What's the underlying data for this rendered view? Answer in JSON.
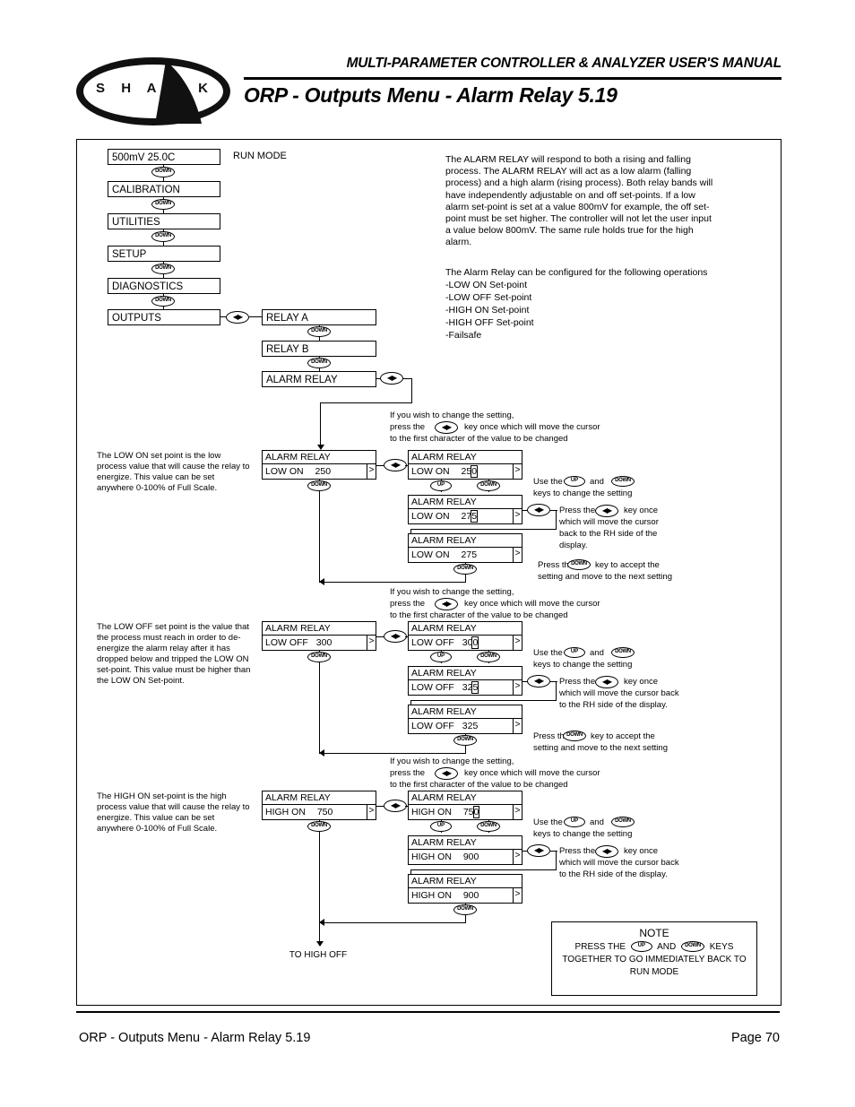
{
  "header": {
    "manual_title": "MULTI-PARAMETER CONTROLLER & ANALYZER USER'S MANUAL",
    "page_heading": "ORP - Outputs Menu - Alarm Relay 5.19",
    "logo_text": "S H A R K"
  },
  "footer": {
    "left": "ORP - Outputs Menu - Alarm Relay 5.19",
    "right": "Page 70"
  },
  "keys": {
    "down": "DOWN",
    "up": "UP",
    "leftright": "◀▶"
  },
  "menu": {
    "run_mode_label": "RUN MODE",
    "items": [
      {
        "label": "500mV  25.0C"
      },
      {
        "label": "CALIBRATION"
      },
      {
        "label": "UTILITIES"
      },
      {
        "label": "SETUP"
      },
      {
        "label": "DIAGNOSTICS"
      },
      {
        "label": "OUTPUTS"
      }
    ],
    "relays": [
      {
        "label": "RELAY A"
      },
      {
        "label": "RELAY B"
      },
      {
        "label": "ALARM RELAY"
      }
    ]
  },
  "description": {
    "paragraph": "The ALARM RELAY will respond to both a rising and falling process. The ALARM RELAY will act as a low alarm (falling process) and a high alarm (rising process). Both relay bands will have independently adjustable on and off set-points.  If a low alarm set-point is set at a value 800mV for example, the off set-point must be set higher. The controller will not let the user input a value below 800mV. The same rule holds true for the high alarm.",
    "config_intro": "The Alarm Relay can be configured for the following operations",
    "config_items": [
      "-LOW ON Set-point",
      "-LOW OFF Set-point",
      "-HIGH ON Set-point",
      "-HIGH OFF Set-point",
      "-Failsafe"
    ]
  },
  "instructions": {
    "change_setting_l1": "If you wish to change the setting,",
    "change_setting_l2a": "press the",
    "change_setting_l2b": "key once which will move the cursor",
    "change_setting_l3": "to the first character of the value to be changed",
    "use_keys_a": "Use the",
    "use_keys_b": "and",
    "use_keys_c": "keys to change the setting",
    "press_lr_a": "Press the",
    "press_lr_b": "key once",
    "press_lr_c2": "which will move the cursor",
    "press_lr_c3": "back to the RH side of the",
    "press_lr_c4": "display.",
    "press_lr_w2": "which will move the cursor back",
    "press_lr_w3": "to the RH side of the display.",
    "accept_a": "Press the",
    "accept_b": "key to accept the",
    "accept_c": "setting and move to the next setting"
  },
  "sections": [
    {
      "id": "low-on",
      "note": "The LOW ON set point is the low process value that will cause the relay to energize. This value can be set anywhere 0-100% of Full Scale.",
      "lcd_title": "ALARM RELAY",
      "main": {
        "label": "LOW  ON",
        "value": "250"
      },
      "edit1": {
        "label": "LOW  ON",
        "value_pre": "25",
        "value_hl": "0"
      },
      "edit2": {
        "label": "LOW  ON",
        "value_pre": "27",
        "value_hl": "5"
      },
      "final": {
        "label": "LOW  ON",
        "value": "275"
      }
    },
    {
      "id": "low-off",
      "note": "The LOW OFF set point is the value that the process must reach in order to de-energize the alarm relay after it has dropped below and tripped the LOW ON set-point. This value must be higher than the LOW ON Set-point.",
      "lcd_title": "ALARM RELAY",
      "main": {
        "label": "LOW  OFF",
        "value": "300"
      },
      "edit1": {
        "label": "LOW  OFF",
        "value_pre": "30",
        "value_hl": "0"
      },
      "edit2": {
        "label": "LOW  OFF",
        "value_pre": "32",
        "value_hl": "5"
      },
      "final": {
        "label": "LOW  OFF",
        "value": "325"
      }
    },
    {
      "id": "high-on",
      "note": "The HIGH ON set-point is the high process value that will cause the relay to energize. This value can be set anywhere 0-100% of Full Scale.",
      "lcd_title": "ALARM RELAY",
      "main": {
        "label": "HIGH ON",
        "value": "750"
      },
      "edit1": {
        "label": "HIGH ON",
        "value_pre": "75",
        "value_hl": "0"
      },
      "edit2": {
        "label": "HIGH ON",
        "value_pre": "900",
        "value_hl": ""
      },
      "final": {
        "label": "HIGH ON",
        "value": "900"
      }
    }
  ],
  "note_box": {
    "title": "NOTE",
    "line1a": "PRESS THE",
    "line1b": "AND",
    "line1c": "KEYS",
    "line2": "TOGETHER TO GO IMMEDIATELY BACK TO",
    "line3": "RUN MODE"
  },
  "to_high_off": "TO HIGH OFF"
}
